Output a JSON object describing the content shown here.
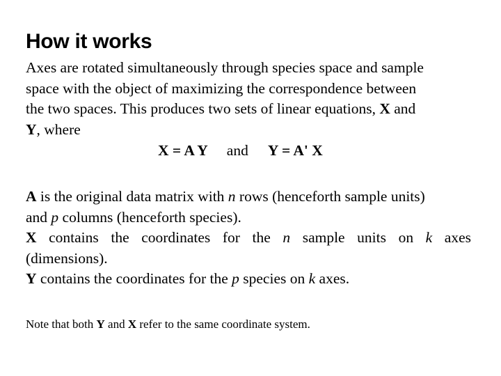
{
  "slide": {
    "title": "How it works",
    "intro": {
      "line1": "Axes are rotated simultaneously through species space and sample",
      "line2": "space with the object of maximizing the correspondence between",
      "line3_a": "the two spaces.  This produces two sets of linear equations, ",
      "line3_X": "X",
      "line3_b": " and",
      "line4_Y": "Y",
      "line4_b": ", where"
    },
    "equations": {
      "eq1": "X = A Y",
      "connector": "and",
      "eq2": "Y = A' X"
    },
    "definitions": {
      "a_sym": "A",
      "a_text1": " is the original data matrix with ",
      "a_n": "n",
      "a_text2": " rows (henceforth sample units)",
      "a_text3": "and ",
      "a_p": "p",
      "a_text4": " columns (henceforth species).",
      "x_sym": "X",
      "x_text1": " contains the coordinates for the ",
      "x_n": "n",
      "x_text2": " sample units on ",
      "x_k": "k",
      "x_text3": " axes",
      "x_text4": "(dimensions).",
      "y_sym": "Y",
      "y_text1": " contains the coordinates for the ",
      "y_p": "p",
      "y_text2": " species on ",
      "y_k": "k",
      "y_text3": " axes."
    },
    "note": {
      "text1": "Note that both ",
      "Y": "Y",
      "text2": " and ",
      "X": "X",
      "text3": " refer to the same coordinate system."
    }
  }
}
